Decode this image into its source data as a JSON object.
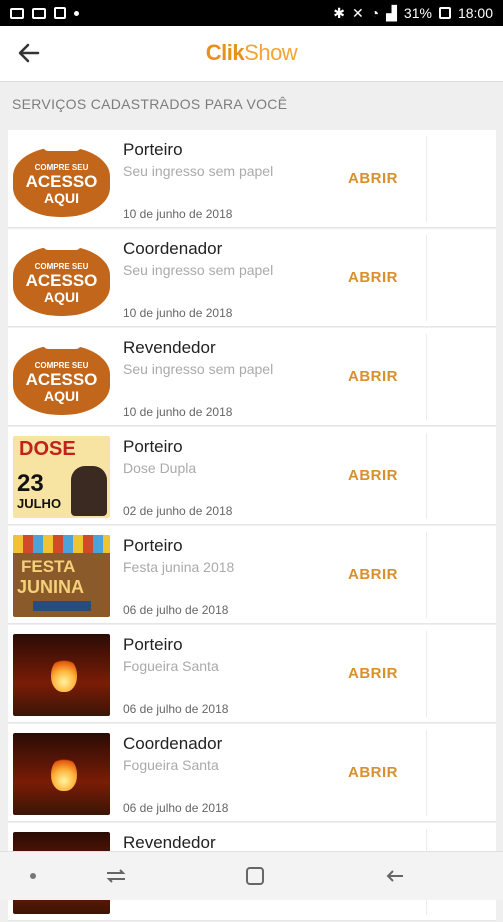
{
  "status_bar": {
    "battery": "31%",
    "time": "18:00",
    "icons": [
      "tv-icon",
      "image-icon",
      "box-icon",
      "dot-icon",
      "bluetooth-icon",
      "mute-icon",
      "wifi-icon",
      "signal-icon",
      "battery-icon"
    ]
  },
  "appbar": {
    "logo_part1": "Clik",
    "logo_part2": "Show",
    "back_icon": "arrow-left-icon"
  },
  "section_title": "SERVIÇOS CADASTRADOS PARA VOCÊ",
  "rows": [
    {
      "title": "Porteiro",
      "subtitle": "Seu ingresso sem papel",
      "date": "10 de junho de 2018",
      "action": "ABRIR",
      "thumb": "acesso",
      "thumb_text": [
        "COMPRE SEU",
        "ACESSO",
        "AQUI"
      ]
    },
    {
      "title": "Coordenador",
      "subtitle": "Seu ingresso sem papel",
      "date": "10 de junho de 2018",
      "action": "ABRIR",
      "thumb": "acesso",
      "thumb_text": [
        "COMPRE SEU",
        "ACESSO",
        "AQUI"
      ]
    },
    {
      "title": "Revendedor",
      "subtitle": "Seu ingresso sem papel",
      "date": "10 de junho de 2018",
      "action": "ABRIR",
      "thumb": "acesso",
      "thumb_text": [
        "COMPRE SEU",
        "ACESSO",
        "AQUI"
      ]
    },
    {
      "title": "Porteiro",
      "subtitle": "Dose Dupla",
      "date": "02 de junho de 2018",
      "action": "ABRIR",
      "thumb": "dose",
      "thumb_text": [
        "DOSE",
        "23",
        "JULHO"
      ]
    },
    {
      "title": "Porteiro",
      "subtitle": "Festa junina 2018",
      "date": "06 de julho de 2018",
      "action": "ABRIR",
      "thumb": "festa",
      "thumb_text": [
        "FESTA",
        "JUNINA"
      ]
    },
    {
      "title": "Porteiro",
      "subtitle": "Fogueira Santa",
      "date": "06 de julho de 2018",
      "action": "ABRIR",
      "thumb": "fire"
    },
    {
      "title": "Coordenador",
      "subtitle": "Fogueira Santa",
      "date": "06 de julho de 2018",
      "action": "ABRIR",
      "thumb": "fire"
    },
    {
      "title": "Revendedor",
      "subtitle": "",
      "date": "",
      "action": "",
      "thumb": "fire"
    }
  ],
  "nav": {
    "items": [
      "dot-icon",
      "recent-apps-icon",
      "home-icon",
      "back-icon"
    ]
  }
}
